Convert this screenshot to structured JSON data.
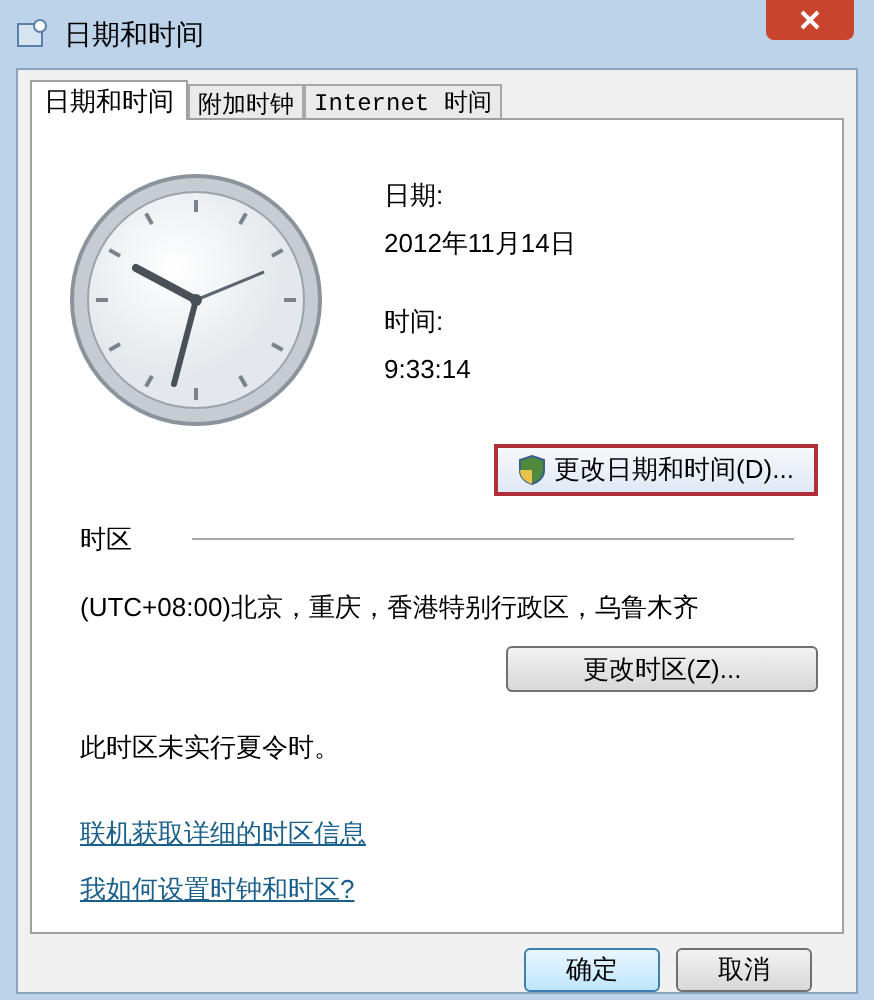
{
  "window": {
    "title": "日期和时间"
  },
  "tabs": [
    {
      "label": "日期和时间",
      "selected": true
    },
    {
      "label": "附加时钟",
      "selected": false
    },
    {
      "label": "Internet 时间",
      "selected": false
    }
  ],
  "date": {
    "label": "日期:",
    "value": "2012年11月14日"
  },
  "time": {
    "label": "时间:",
    "value": "9:33:14"
  },
  "change_datetime_button": "更改日期和时间(D)...",
  "timezone": {
    "heading": "时区",
    "value": "(UTC+08:00)北京，重庆，香港特别行政区，乌鲁木齐",
    "button": "更改时区(Z)...",
    "dst_note": "此时区未实行夏令时。"
  },
  "links": [
    "联机获取详细的时区信息",
    "我如何设置时钟和时区?"
  ],
  "buttons": [
    "确定",
    "取消"
  ]
}
